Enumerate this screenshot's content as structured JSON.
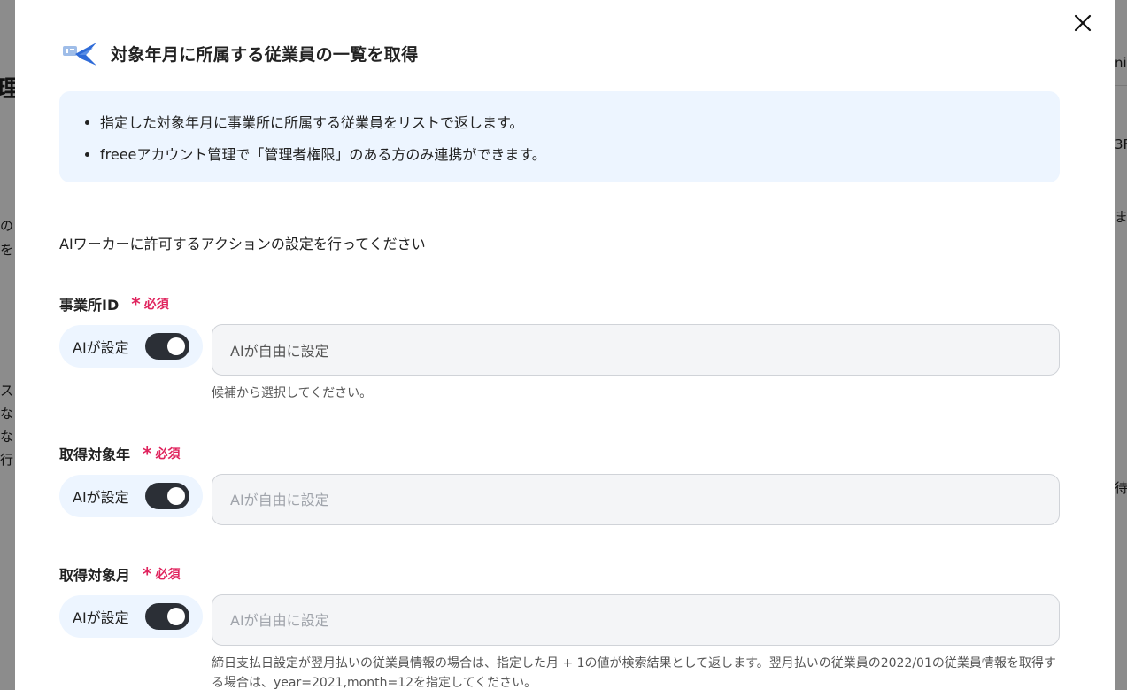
{
  "background": {
    "fragments": [
      "理ギ",
      "ni",
      "3F",
      "の",
      "ま",
      "を",
      "ス",
      "な",
      "な",
      "行",
      "待"
    ]
  },
  "modal": {
    "title": "対象年月に所属する従業員の一覧を取得",
    "close_icon": "close-icon",
    "logo_icon": "freee-bird-logo",
    "info_items": [
      "指定した対象年月に事業所に所属する従業員をリストで返します。",
      "freeeアカウント管理で「管理者権限」のある方のみ連携ができます。"
    ],
    "instruction": "AIワーカーに許可するアクションの設定を行ってください",
    "required_label": "必須",
    "fields": [
      {
        "label": "事業所ID",
        "toggle_label": "AIが設定",
        "toggle_on": true,
        "value": "AIが自由に設定",
        "help": "候補から選択してください。"
      },
      {
        "label": "取得対象年",
        "toggle_label": "AIが設定",
        "toggle_on": true,
        "placeholder": "AIが自由に設定"
      },
      {
        "label": "取得対象月",
        "toggle_label": "AIが設定",
        "toggle_on": true,
        "placeholder": "AIが自由に設定",
        "help": "締日支払日設定が翌月払いの従業員情報の場合は、指定した月 + 1の値が検索結果として返します。翌月払いの従業員の2022/01の従業員情報を取得する場合は、year=2021,month=12を指定してください。"
      }
    ]
  },
  "colors": {
    "accent_required": "#e0245e",
    "info_bg": "#edf5ff",
    "toggle_on": "#2b2f36"
  }
}
